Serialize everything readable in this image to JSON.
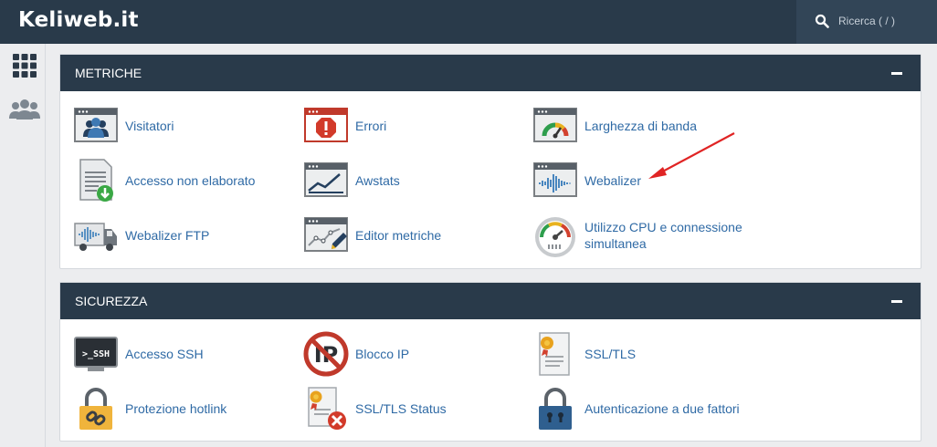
{
  "brand": {
    "name": "Keliweb.it"
  },
  "search": {
    "placeholder": "Ricerca ( / )"
  },
  "sidebar": {
    "items": [
      {
        "icon": "grid-icon"
      },
      {
        "icon": "users-icon"
      }
    ]
  },
  "metrics": {
    "title": "METRICHE",
    "items": [
      {
        "label": "Visitatori",
        "icon": "visitors-icon"
      },
      {
        "label": "Errori",
        "icon": "errors-icon"
      },
      {
        "label": "Larghezza di banda",
        "icon": "bandwidth-icon"
      },
      {
        "label": "Accesso non elaborato",
        "icon": "raw-access-icon"
      },
      {
        "label": "Awstats",
        "icon": "awstats-icon"
      },
      {
        "label": "Webalizer",
        "icon": "webalizer-icon"
      },
      {
        "label": "Webalizer FTP",
        "icon": "webalizer-ftp-icon"
      },
      {
        "label": "Editor metriche",
        "icon": "metrics-editor-icon"
      },
      {
        "label": "Utilizzo CPU e connessione",
        "label2": "simultanea",
        "icon": "cpu-usage-icon"
      }
    ]
  },
  "security": {
    "title": "SICUREZZA",
    "items": [
      {
        "label": "Accesso SSH",
        "icon": "ssh-icon",
        "icon_text": ">_SSH"
      },
      {
        "label": "Blocco IP",
        "icon": "ip-block-icon",
        "icon_text": "IP"
      },
      {
        "label": "SSL/TLS",
        "icon": "ssl-tls-icon"
      },
      {
        "label": "Protezione hotlink",
        "icon": "hotlink-icon"
      },
      {
        "label": "SSL/TLS Status",
        "icon": "ssl-status-icon"
      },
      {
        "label": "Autenticazione a due fattori",
        "icon": "two-factor-icon"
      }
    ]
  },
  "colors": {
    "header": "#293a4a",
    "link": "#2f6aa5",
    "annotation_arrow": "#e02424"
  }
}
